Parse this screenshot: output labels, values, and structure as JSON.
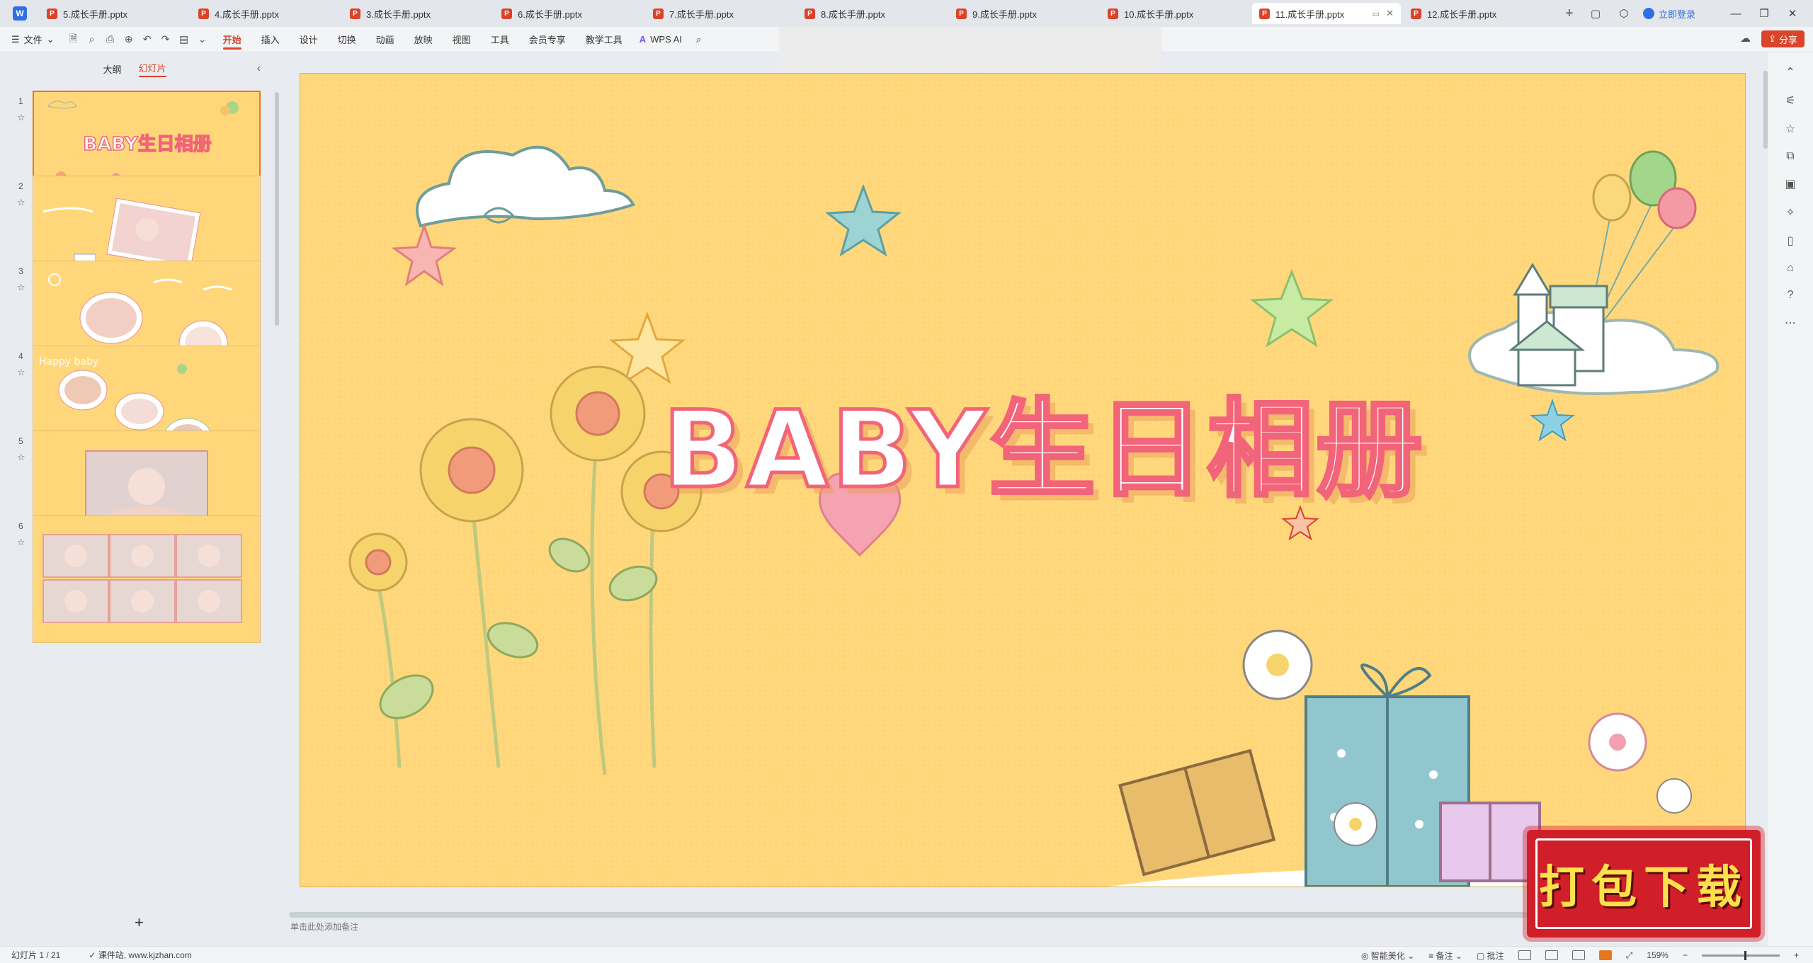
{
  "tabs": [
    {
      "label": "5.成长手册.pptx"
    },
    {
      "label": "4.成长手册.pptx"
    },
    {
      "label": "3.成长手册.pptx"
    },
    {
      "label": "6.成长手册.pptx"
    },
    {
      "label": "7.成长手册.pptx"
    },
    {
      "label": "8.成长手册.pptx"
    },
    {
      "label": "9.成长手册.pptx"
    },
    {
      "label": "10.成长手册.pptx"
    },
    {
      "label": "11.成长手册.pptx",
      "active": true
    },
    {
      "label": "12.成长手册.pptx"
    }
  ],
  "login_label": "立即登录",
  "menu": {
    "file_label": "文件",
    "ribbon_tabs": [
      "开始",
      "插入",
      "设计",
      "切换",
      "动画",
      "放映",
      "视图",
      "工具",
      "会员专享",
      "教学工具"
    ],
    "active_tab": "开始",
    "wps_ai_label": "WPS AI",
    "share_label": "分享"
  },
  "left_panel": {
    "outline_label": "大纲",
    "slides_label": "幻灯片",
    "slide_numbers": [
      "1",
      "2",
      "3",
      "4",
      "5",
      "6"
    ],
    "thumb1_title": "BABY生日相册",
    "thumb4_text": "Happy baby",
    "add_label": "+"
  },
  "slide": {
    "title": "BABY生日相册"
  },
  "notes_placeholder": "单击此处添加备注",
  "status": {
    "slide_counter": "幻灯片 1 / 21",
    "source": "课件站, www.kjzhan.com",
    "smart_beautify": "智能美化",
    "notes_label": "备注",
    "comments_label": "批注",
    "zoom": "159%"
  },
  "watermark_text": "打包下载",
  "colors": {
    "slide_bg": "#ffd77a",
    "title_stroke": "#f26479",
    "accent": "#d9442b",
    "active_thumb_border": "#e8781f"
  }
}
